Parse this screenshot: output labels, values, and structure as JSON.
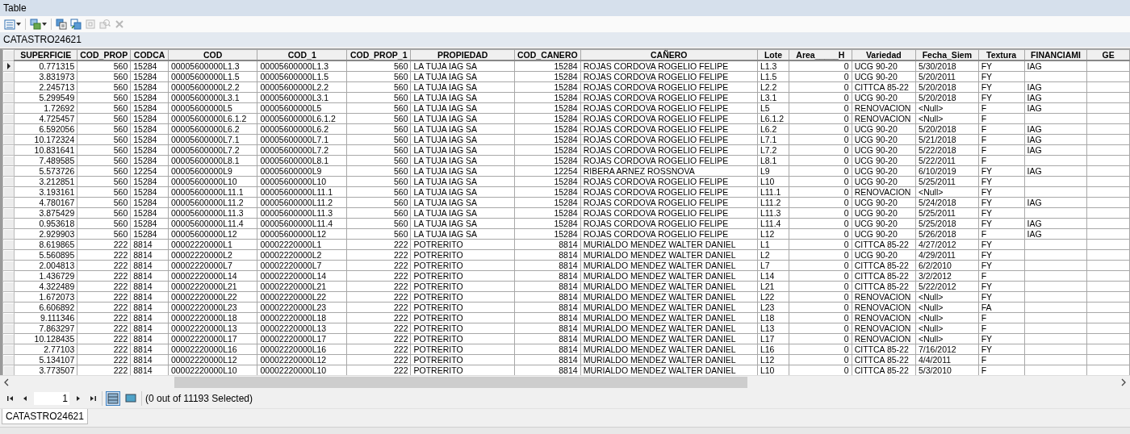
{
  "window": {
    "title": "Table"
  },
  "toolbar": [
    {
      "kind": "table-options",
      "disabled": false
    },
    {
      "kind": "related-tables",
      "disabled": false
    },
    {
      "kind": "select-by-attributes",
      "disabled": false
    },
    {
      "kind": "switch-selection",
      "disabled": false
    },
    {
      "kind": "clear-selection",
      "disabled": true
    },
    {
      "kind": "zoom-selected",
      "disabled": true
    },
    {
      "kind": "delete",
      "disabled": true
    }
  ],
  "table_name": "CATASTRO24621",
  "table": {
    "columns": [
      {
        "label": "SUPERFICIE",
        "kind": "number"
      },
      {
        "label": "COD_PROP",
        "kind": "number"
      },
      {
        "label": "CODCA",
        "kind": "text"
      },
      {
        "label": "COD",
        "kind": "text"
      },
      {
        "label": "COD_1",
        "kind": "text"
      },
      {
        "label": "COD_PROP_1",
        "kind": "number"
      },
      {
        "label": "PROPIEDAD",
        "kind": "text"
      },
      {
        "label": "COD_CANERO",
        "kind": "number"
      },
      {
        "label": "CAÑERO",
        "kind": "text"
      },
      {
        "label": "Lote",
        "kind": "text"
      },
      {
        "label": "Area_____H",
        "kind": "number"
      },
      {
        "label": "Variedad",
        "kind": "text"
      },
      {
        "label": "Fecha_Siem",
        "kind": "text"
      },
      {
        "label": "Textura",
        "kind": "text"
      },
      {
        "label": "FINANCIAMI",
        "kind": "text"
      },
      {
        "label": "GE",
        "kind": "text"
      }
    ],
    "rows": [
      {
        "current": true,
        "cells": [
          "0.771315",
          "560",
          "15284",
          "00005600000L1.3",
          "00005600000L1.3",
          "560",
          "LA TUJA IAG SA",
          "15284",
          "ROJAS CORDOVA ROGELIO FELIPE",
          "L1.3",
          "0",
          "UCG 90-20",
          "5/30/2018",
          "FY",
          "IAG"
        ]
      },
      {
        "current": false,
        "cells": [
          "3.831973",
          "560",
          "15284",
          "00005600000L1.5",
          "00005600000L1.5",
          "560",
          "LA TUJA IAG SA",
          "15284",
          "ROJAS CORDOVA ROGELIO FELIPE",
          "L1.5",
          "0",
          "UCG 90-20",
          "5/20/2011",
          "FY",
          null
        ]
      },
      {
        "current": false,
        "cells": [
          "2.245713",
          "560",
          "15284",
          "00005600000L2.2",
          "00005600000L2.2",
          "560",
          "LA TUJA IAG SA",
          "15284",
          "ROJAS CORDOVA ROGELIO FELIPE",
          "L2.2",
          "0",
          "CITTCA 85-22",
          "5/20/2018",
          "FY",
          "IAG"
        ]
      },
      {
        "current": false,
        "cells": [
          "5.299549",
          "560",
          "15284",
          "00005600000L3.1",
          "00005600000L3.1",
          "560",
          "LA TUJA IAG SA",
          "15284",
          "ROJAS CORDOVA ROGELIO FELIPE",
          "L3.1",
          "0",
          "UCG 90-20",
          "5/20/2018",
          "FY",
          "IAG"
        ]
      },
      {
        "current": false,
        "cells": [
          "1.72692",
          "560",
          "15284",
          "00005600000L5",
          "00005600000L5",
          "560",
          "LA TUJA IAG SA",
          "15284",
          "ROJAS CORDOVA ROGELIO FELIPE",
          "L5",
          "0",
          "RENOVACION",
          "<Null>",
          "F",
          "IAG"
        ]
      },
      {
        "current": false,
        "cells": [
          "4.725457",
          "560",
          "15284",
          "00005600000L6.1.2",
          "00005600000L6.1.2",
          "560",
          "LA TUJA IAG SA",
          "15284",
          "ROJAS CORDOVA ROGELIO FELIPE",
          "L6.1.2",
          "0",
          "RENOVACION",
          "<Null>",
          "F",
          null
        ]
      },
      {
        "current": false,
        "cells": [
          "6.592056",
          "560",
          "15284",
          "00005600000L6.2",
          "00005600000L6.2",
          "560",
          "LA TUJA IAG SA",
          "15284",
          "ROJAS CORDOVA ROGELIO FELIPE",
          "L6.2",
          "0",
          "UCG 90-20",
          "5/20/2018",
          "F",
          "IAG"
        ]
      },
      {
        "current": false,
        "cells": [
          "10.172324",
          "560",
          "15284",
          "00005600000L7.1",
          "00005600000L7.1",
          "560",
          "LA TUJA IAG SA",
          "15284",
          "ROJAS CORDOVA ROGELIO FELIPE",
          "L7.1",
          "0",
          "UCG 90-20",
          "5/21/2018",
          "F",
          "IAG"
        ]
      },
      {
        "current": false,
        "cells": [
          "10.831641",
          "560",
          "15284",
          "00005600000L7.2",
          "00005600000L7.2",
          "560",
          "LA TUJA IAG SA",
          "15284",
          "ROJAS CORDOVA ROGELIO FELIPE",
          "L7.2",
          "0",
          "UCG 90-20",
          "5/22/2018",
          "F",
          "IAG"
        ]
      },
      {
        "current": false,
        "cells": [
          "7.489585",
          "560",
          "15284",
          "00005600000L8.1",
          "00005600000L8.1",
          "560",
          "LA TUJA IAG SA",
          "15284",
          "ROJAS CORDOVA ROGELIO FELIPE",
          "L8.1",
          "0",
          "UCG 90-20",
          "5/22/2011",
          "F",
          null
        ]
      },
      {
        "current": false,
        "cells": [
          "5.573726",
          "560",
          "12254",
          "00005600000L9",
          "00005600000L9",
          "560",
          "LA TUJA IAG SA",
          "12254",
          "RIBERA ARNEZ ROSSNOVA",
          "L9",
          "0",
          "UCG 90-20",
          "6/10/2019",
          "FY",
          "IAG"
        ]
      },
      {
        "current": false,
        "cells": [
          "3.212851",
          "560",
          "15284",
          "00005600000L10",
          "00005600000L10",
          "560",
          "LA TUJA IAG SA",
          "15284",
          "ROJAS CORDOVA ROGELIO FELIPE",
          "L10",
          "0",
          "UCG 90-20",
          "5/25/2011",
          "FY",
          null
        ]
      },
      {
        "current": false,
        "cells": [
          "3.193161",
          "560",
          "15284",
          "00005600000L11.1",
          "00005600000L11.1",
          "560",
          "LA TUJA IAG SA",
          "15284",
          "ROJAS CORDOVA ROGELIO FELIPE",
          "L11.1",
          "0",
          "RENOVACION",
          "<Null>",
          "FY",
          null
        ]
      },
      {
        "current": false,
        "cells": [
          "4.780167",
          "560",
          "15284",
          "00005600000L11.2",
          "00005600000L11.2",
          "560",
          "LA TUJA IAG SA",
          "15284",
          "ROJAS CORDOVA ROGELIO FELIPE",
          "L11.2",
          "0",
          "UCG 90-20",
          "5/24/2018",
          "FY",
          "IAG"
        ]
      },
      {
        "current": false,
        "cells": [
          "3.875429",
          "560",
          "15284",
          "00005600000L11.3",
          "00005600000L11.3",
          "560",
          "LA TUJA IAG SA",
          "15284",
          "ROJAS CORDOVA ROGELIO FELIPE",
          "L11.3",
          "0",
          "UCG 90-20",
          "5/25/2011",
          "FY",
          null
        ]
      },
      {
        "current": false,
        "cells": [
          "0.953618",
          "560",
          "15284",
          "00005600000L11.4",
          "00005600000L11.4",
          "560",
          "LA TUJA IAG SA",
          "15284",
          "ROJAS CORDOVA ROGELIO FELIPE",
          "L11.4",
          "0",
          "UCG 90-20",
          "5/25/2018",
          "FY",
          "IAG"
        ]
      },
      {
        "current": false,
        "cells": [
          "2.929903",
          "560",
          "15284",
          "00005600000L12",
          "00005600000L12",
          "560",
          "LA TUJA IAG SA",
          "15284",
          "ROJAS CORDOVA ROGELIO FELIPE",
          "L12",
          "0",
          "UCG 90-20",
          "5/26/2018",
          "F",
          "IAG"
        ]
      },
      {
        "current": false,
        "cells": [
          "8.619865",
          "222",
          "8814",
          "00002220000L1",
          "00002220000L1",
          "222",
          "POTRERITO",
          "8814",
          "MURIALDO MENDEZ WALTER DANIEL",
          "L1",
          "0",
          "CITTCA 85-22",
          "4/27/2012",
          "FY",
          null
        ]
      },
      {
        "current": false,
        "cells": [
          "5.560895",
          "222",
          "8814",
          "00002220000L2",
          "00002220000L2",
          "222",
          "POTRERITO",
          "8814",
          "MURIALDO MENDEZ WALTER DANIEL",
          "L2",
          "0",
          "UCG 90-20",
          "4/29/2011",
          "FY",
          null
        ]
      },
      {
        "current": false,
        "cells": [
          "2.004813",
          "222",
          "8814",
          "00002220000L7",
          "00002220000L7",
          "222",
          "POTRERITO",
          "8814",
          "MURIALDO MENDEZ WALTER DANIEL",
          "L7",
          "0",
          "CITTCA 85-22",
          "6/2/2010",
          "FY",
          null
        ]
      },
      {
        "current": false,
        "cells": [
          "1.436729",
          "222",
          "8814",
          "00002220000L14",
          "00002220000L14",
          "222",
          "POTRERITO",
          "8814",
          "MURIALDO MENDEZ WALTER DANIEL",
          "L14",
          "0",
          "CITTCA 85-22",
          "3/2/2012",
          "F",
          null
        ]
      },
      {
        "current": false,
        "cells": [
          "4.322489",
          "222",
          "8814",
          "00002220000L21",
          "00002220000L21",
          "222",
          "POTRERITO",
          "8814",
          "MURIALDO MENDEZ WALTER DANIEL",
          "L21",
          "0",
          "CITTCA 85-22",
          "5/22/2012",
          "FY",
          null
        ]
      },
      {
        "current": false,
        "cells": [
          "1.672073",
          "222",
          "8814",
          "00002220000L22",
          "00002220000L22",
          "222",
          "POTRERITO",
          "8814",
          "MURIALDO MENDEZ WALTER DANIEL",
          "L22",
          "0",
          "RENOVACION",
          "<Null>",
          "FY",
          null
        ]
      },
      {
        "current": false,
        "cells": [
          "6.606892",
          "222",
          "8814",
          "00002220000L23",
          "00002220000L23",
          "222",
          "POTRERITO",
          "8814",
          "MURIALDO MENDEZ WALTER DANIEL",
          "L23",
          "0",
          "RENOVACION",
          "<Null>",
          "FA",
          null
        ]
      },
      {
        "current": false,
        "cells": [
          "9.111346",
          "222",
          "8814",
          "00002220000L18",
          "00002220000L18",
          "222",
          "POTRERITO",
          "8814",
          "MURIALDO MENDEZ WALTER DANIEL",
          "L18",
          "0",
          "RENOVACION",
          "<Null>",
          "F",
          null
        ]
      },
      {
        "current": false,
        "cells": [
          "7.863297",
          "222",
          "8814",
          "00002220000L13",
          "00002220000L13",
          "222",
          "POTRERITO",
          "8814",
          "MURIALDO MENDEZ WALTER DANIEL",
          "L13",
          "0",
          "RENOVACION",
          "<Null>",
          "F",
          null
        ]
      },
      {
        "current": false,
        "cells": [
          "10.128435",
          "222",
          "8814",
          "00002220000L17",
          "00002220000L17",
          "222",
          "POTRERITO",
          "8814",
          "MURIALDO MENDEZ WALTER DANIEL",
          "L17",
          "0",
          "RENOVACION",
          "<Null>",
          "FY",
          null
        ]
      },
      {
        "current": false,
        "cells": [
          "2.77103",
          "222",
          "8814",
          "00002220000L16",
          "00002220000L16",
          "222",
          "POTRERITO",
          "8814",
          "MURIALDO MENDEZ WALTER DANIEL",
          "L16",
          "0",
          "CITTCA 85-22",
          "7/16/2012",
          "FY",
          null
        ]
      },
      {
        "current": false,
        "cells": [
          "5.134107",
          "222",
          "8814",
          "00002220000L12",
          "00002220000L12",
          "222",
          "POTRERITO",
          "8814",
          "MURIALDO MENDEZ WALTER DANIEL",
          "L12",
          "0",
          "CITTCA 85-22",
          "4/4/2011",
          "F",
          null
        ]
      },
      {
        "current": false,
        "cells": [
          "3.773507",
          "222",
          "8814",
          "00002220000L10",
          "00002220000L10",
          "222",
          "POTRERITO",
          "8814",
          "MURIALDO MENDEZ WALTER DANIEL",
          "L10",
          "0",
          "CITTCA 85-22",
          "5/3/2010",
          "F",
          null
        ]
      }
    ]
  },
  "navigation": {
    "page": "1",
    "views": [
      {
        "kind": "all-records",
        "selected": true
      },
      {
        "kind": "selected-records",
        "selected": false
      }
    ],
    "selection_text": "(0 out of 11193 Selected)"
  },
  "tabs": [
    {
      "label": "CATASTRO24621",
      "selected": true
    }
  ]
}
